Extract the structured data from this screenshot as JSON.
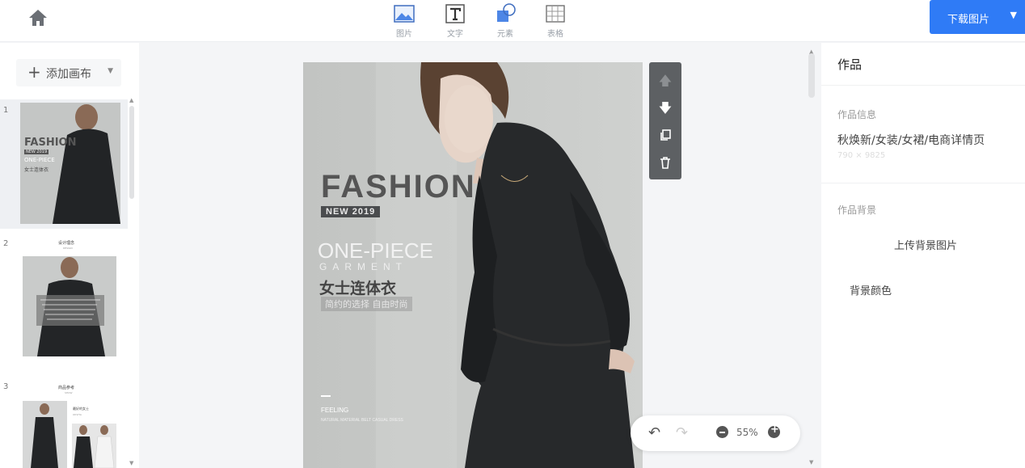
{
  "header": {
    "tools": [
      {
        "label": "图片",
        "icon": "image-icon"
      },
      {
        "label": "文字",
        "icon": "text-icon"
      },
      {
        "label": "元素",
        "icon": "shapes-icon"
      },
      {
        "label": "表格",
        "icon": "table-icon"
      }
    ],
    "download_label": "下载图片"
  },
  "left": {
    "add_canvas_label": "添加画布",
    "pages": [
      {
        "num": "1",
        "heading": "FASHION",
        "sub": "NEW 2019",
        "line1": "ONE-PIECE",
        "line2": "女士连体衣"
      },
      {
        "num": "2",
        "heading": "设计理念",
        "sub": "DESIGN"
      },
      {
        "num": "3",
        "heading": "商品参考",
        "sub": "SHOW",
        "caption": "最好的女士",
        "caption2": "OKVITA"
      }
    ]
  },
  "canvas": {
    "title": "FASHION",
    "badge": "NEW 2019",
    "line1": "ONE-PIECE",
    "line2": "GARMENT",
    "line3": "女士连体衣",
    "line4": "简约的选择 自由时尚",
    "feeling": "FEELING",
    "feeling_sub": "NATURAL MATERIAL   BELT   CASUAL DRESS",
    "zoom": "55%"
  },
  "right": {
    "title": "作品",
    "info_label": "作品信息",
    "work_name": "秋焕新/女装/女裙/电商详情页",
    "work_size": "790 × 9825",
    "bg_label": "作品背景",
    "upload_label": "上传背景图片",
    "bgcolor_label": "背景颜色"
  }
}
